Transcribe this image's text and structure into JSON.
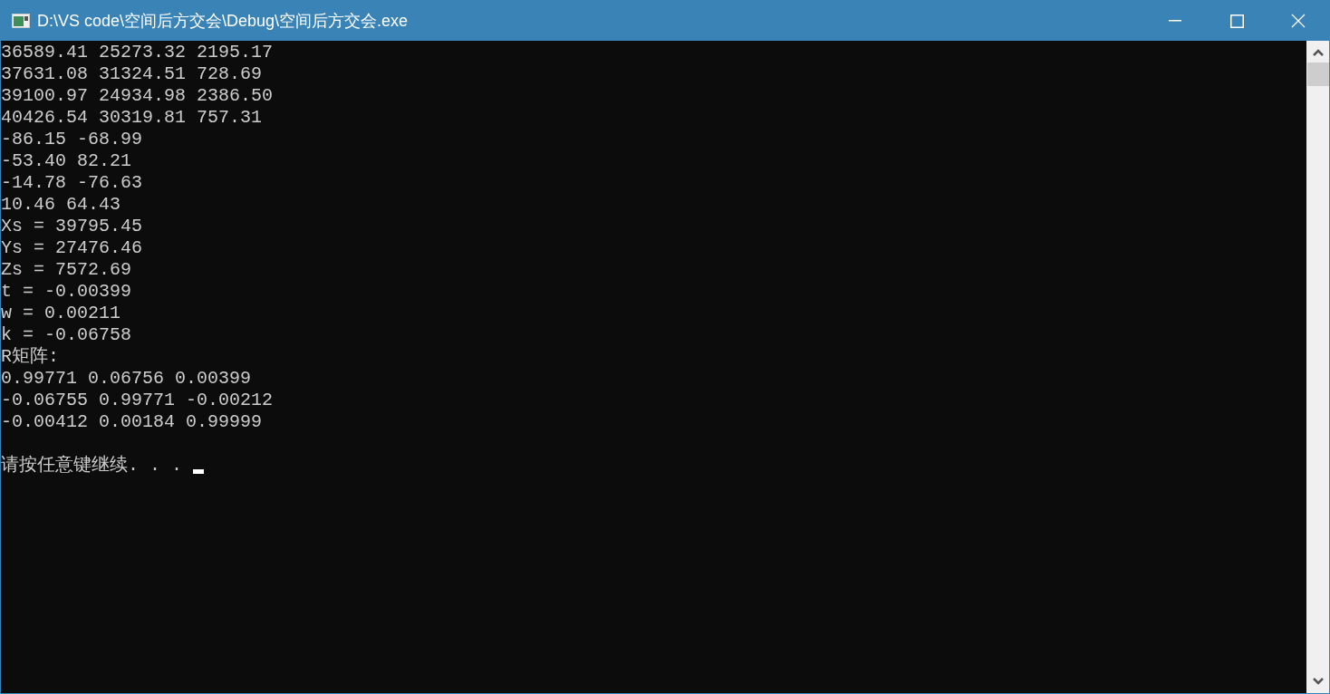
{
  "window": {
    "title": "D:\\VS code\\空间后方交会\\Debug\\空间后方交会.exe"
  },
  "console": {
    "lines": [
      "36589.41 25273.32 2195.17",
      "37631.08 31324.51 728.69",
      "39100.97 24934.98 2386.50",
      "40426.54 30319.81 757.31",
      "-86.15 -68.99",
      "-53.40 82.21",
      "-14.78 -76.63",
      "10.46 64.43",
      "Xs = 39795.45",
      "Ys = 27476.46",
      "Zs = 7572.69",
      "t = -0.00399",
      "w = 0.00211",
      "k = -0.06758",
      "R矩阵:",
      "0.99771 0.06756 0.00399",
      "-0.06755 0.99771 -0.00212",
      "-0.00412 0.00184 0.99999"
    ],
    "prompt": "请按任意键继续. . ."
  }
}
